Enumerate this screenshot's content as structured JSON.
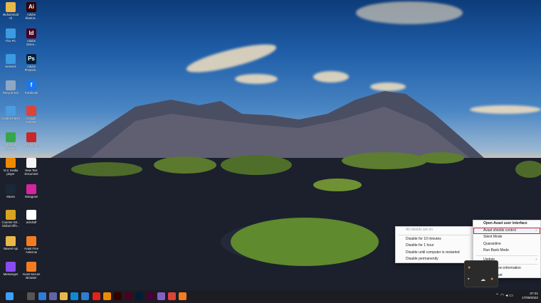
{
  "desktop": {
    "icons": [
      {
        "label": "Muhammad Ali",
        "icon": "folder-icon",
        "color": "#e8b84a",
        "glyph": ""
      },
      {
        "label": "This PC",
        "icon": "computer-icon",
        "color": "#3b9ae1",
        "glyph": ""
      },
      {
        "label": "Network",
        "icon": "network-icon",
        "color": "#3b9ae1",
        "glyph": ""
      },
      {
        "label": "Recycle Bin",
        "icon": "recycle-bin-icon",
        "color": "#8fa7c2",
        "glyph": ""
      },
      {
        "label": "Control Panel",
        "icon": "control-panel-icon",
        "color": "#4c9be0",
        "glyph": ""
      },
      {
        "label": "Internet Downlo...",
        "icon": "internet-download-manager-icon",
        "color": "#37a64a",
        "glyph": ""
      },
      {
        "label": "VLC media player",
        "icon": "vlc-icon",
        "color": "#f08a00",
        "glyph": ""
      },
      {
        "label": "Steam",
        "icon": "steam-icon",
        "color": "#1b2838",
        "glyph": ""
      },
      {
        "label": "Counter-Str... Global Offe...",
        "icon": "csgo-icon",
        "color": "#d9a320",
        "glyph": ""
      },
      {
        "label": "Naveel Api",
        "icon": "folder-icon",
        "color": "#e8b84a",
        "glyph": ""
      },
      {
        "label": "Messenger",
        "icon": "messenger-icon",
        "color": "#8a4cf0",
        "glyph": ""
      },
      {
        "label": "Adobe Illustrat...",
        "icon": "illustrator-icon",
        "color": "#330000",
        "glyph": "Ai"
      },
      {
        "label": "Adobe InDes...",
        "icon": "indesign-icon",
        "color": "#49021f",
        "glyph": "Id"
      },
      {
        "label": "Adobe Photosh...",
        "icon": "photoshop-icon",
        "color": "#001e36",
        "glyph": "Ps"
      },
      {
        "label": "Facebook",
        "icon": "facebook-icon",
        "color": "#1877f2",
        "glyph": "f"
      },
      {
        "label": "Google Chrome",
        "icon": "chrome-icon",
        "color": "#db4437",
        "glyph": ""
      },
      {
        "label": "Aspx Logo...",
        "icon": "aspx-icon",
        "color": "#c62828",
        "glyph": ""
      },
      {
        "label": "New Text Document",
        "icon": "text-document-icon",
        "color": "#f5f5f5",
        "glyph": ""
      },
      {
        "label": "Instagram",
        "icon": "instagram-icon",
        "color": "#d6249f",
        "glyph": ""
      },
      {
        "label": "achdsdf",
        "icon": "blank-file-icon",
        "color": "#ffffff",
        "glyph": ""
      },
      {
        "label": "Avast Free Antivirus",
        "icon": "avast-icon",
        "color": "#f47c20",
        "glyph": ""
      },
      {
        "label": "Avast Secure Browser",
        "icon": "avast-browser-icon",
        "color": "#f47c20",
        "glyph": ""
      }
    ]
  },
  "shields_submenu": {
    "items": [
      {
        "label": "All shields are on",
        "disabled": true
      },
      {
        "label": "Disable for 10 minutes",
        "disabled": false
      },
      {
        "label": "Disable for 1 hour",
        "disabled": false
      },
      {
        "label": "Disable until computer is restarted",
        "disabled": false
      },
      {
        "label": "Disable permanently",
        "disabled": false
      }
    ]
  },
  "avast_menu": {
    "open_ui": "Open Avast user interface",
    "shields_control": "Avast shields control",
    "silent_mode": "Silent Mode",
    "quarantine": "Quarantine",
    "bank_mode": "Run Bank Mode",
    "update": "Update",
    "registration": "Registration information",
    "about": "About Avast",
    "highlight_color": "#d0202a"
  },
  "tray_popup": {
    "icons": [
      "avast-tray-icon",
      "usb-icon",
      "onedrive-icon",
      "avast-orange-icon"
    ]
  },
  "taskbar": {
    "apps": [
      {
        "icon": "windows-start-icon",
        "color": "#3aa0ff"
      },
      {
        "icon": "search-icon",
        "color": "#1c1c22"
      },
      {
        "icon": "task-view-icon",
        "color": "#555"
      },
      {
        "icon": "widgets-icon",
        "color": "#2f7bd9"
      },
      {
        "icon": "teams-chat-icon",
        "color": "#6264a7"
      },
      {
        "icon": "file-explorer-icon",
        "color": "#e8b84a"
      },
      {
        "icon": "edge-icon",
        "color": "#0c8ad8"
      },
      {
        "icon": "store-icon",
        "color": "#2d7dd2"
      },
      {
        "icon": "youtube-icon",
        "color": "#e62117"
      },
      {
        "icon": "vlc-icon",
        "color": "#f08a00"
      },
      {
        "icon": "illustrator-icon",
        "color": "#330000"
      },
      {
        "icon": "indesign-icon",
        "color": "#49021f"
      },
      {
        "icon": "photoshop-icon",
        "color": "#001e36"
      },
      {
        "icon": "xd-icon",
        "color": "#470137"
      },
      {
        "icon": "visual-studio-icon",
        "color": "#865fc5"
      },
      {
        "icon": "chrome-icon",
        "color": "#db4437"
      },
      {
        "icon": "avast-browser-icon",
        "color": "#f47c20"
      }
    ],
    "time": "07:31",
    "date": "17/09/2022"
  }
}
